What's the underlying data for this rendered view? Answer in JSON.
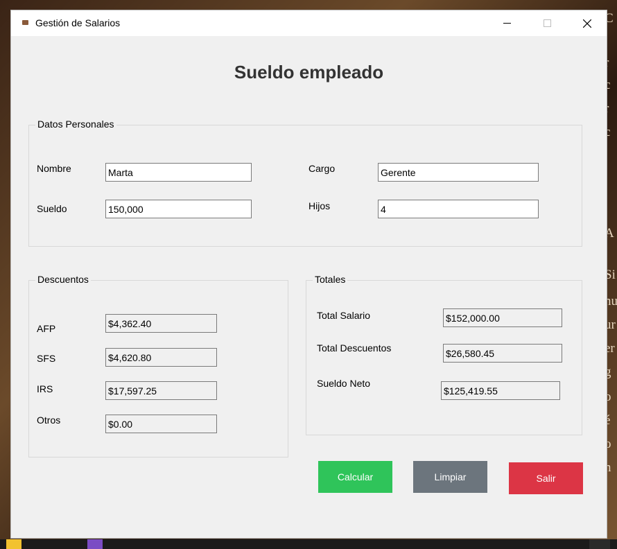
{
  "window": {
    "title": "Gestión de Salarios"
  },
  "heading": "Sueldo empleado",
  "personal": {
    "title": "Datos Personales",
    "nombre_label": "Nombre",
    "nombre_value": "Marta",
    "cargo_label": "Cargo",
    "cargo_value": "Gerente",
    "sueldo_label": "Sueldo",
    "sueldo_value": "150,000",
    "hijos_label": "Hijos",
    "hijos_value": "4"
  },
  "descuentos": {
    "title": "Descuentos",
    "afp_label": "AFP",
    "afp_value": "$4,362.40",
    "sfs_label": "SFS",
    "sfs_value": "$4,620.80",
    "irs_label": "IRS",
    "irs_value": "$17,597.25",
    "otros_label": "Otros",
    "otros_value": "$0.00"
  },
  "totales": {
    "title": "Totales",
    "salario_label": "Total Salario",
    "salario_value": "$152,000.00",
    "descuentos_label": "Total Descuentos",
    "descuentos_value": "$26,580.45",
    "neto_label": "Sueldo Neto",
    "neto_value": "$125,419.55"
  },
  "buttons": {
    "calcular": "Calcular",
    "limpiar": "Limpiar",
    "salir": "Salir"
  },
  "colors": {
    "calcular": "#2fc45a",
    "limpiar": "#6c757d",
    "salir": "#dc3545",
    "window_bg": "#f0f0f0"
  },
  "background_text": [
    "C",
    "r",
    "c",
    "r",
    "c",
    "A",
    "Si",
    "nu",
    "ur",
    "er",
    "g",
    "o",
    "é",
    "o",
    "n"
  ]
}
